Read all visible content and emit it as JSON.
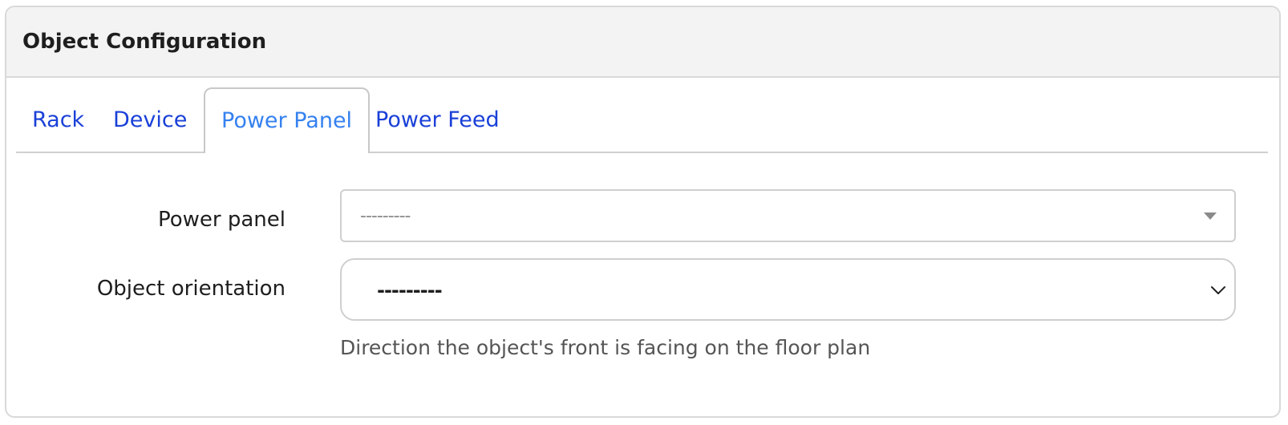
{
  "card": {
    "title": "Object Configuration"
  },
  "tabs": [
    {
      "label": "Rack",
      "active": false
    },
    {
      "label": "Device",
      "active": false
    },
    {
      "label": "Power Panel",
      "active": true
    },
    {
      "label": "Power Feed",
      "active": false
    }
  ],
  "form": {
    "power_panel": {
      "label": "Power panel",
      "value": "---------",
      "icon": "caret-down-icon"
    },
    "object_orientation": {
      "label": "Object orientation",
      "value": "---------",
      "icon": "chevron-down-icon",
      "help_text": "Direction the object's front is facing on the floor plan"
    }
  },
  "colors": {
    "tab_link": "#1a40d8",
    "tab_active": "#3581f0",
    "header_bg": "#f3f3f3",
    "border": "#d9d9d9"
  }
}
